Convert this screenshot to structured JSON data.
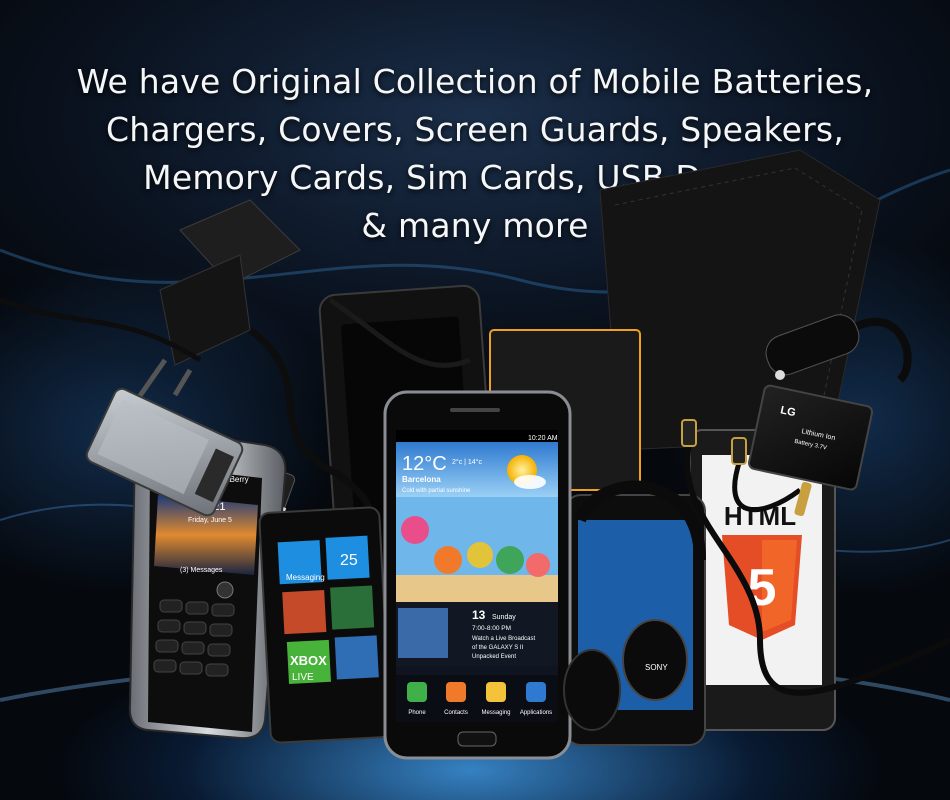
{
  "headline": {
    "line1": "We have Original Collection of Mobile Batteries,",
    "line2": "Chargers, Covers, Screen Guards, Speakers,",
    "line3": "Memory Cards, Sim Cards, USB Devices",
    "line4": "& many more"
  },
  "galaxy_phone": {
    "status_time": "10:20 AM",
    "weather_temp": "12°C",
    "weather_range": "2°c | 14°c",
    "weather_city": "Barcelona",
    "weather_desc": "Cold with partial sunshine",
    "event_date": "13",
    "event_day": "Sunday",
    "event_time": "7:00-8:00 PM",
    "event_line1": "Watch a Live Broadcast",
    "event_line2": "of the GALAXY S II",
    "event_line3": "Unpacked Event",
    "dock": [
      "Phone",
      "Contacts",
      "Messaging",
      "Applications"
    ]
  },
  "blackberry_phone": {
    "time": "12:21",
    "date": "Friday, June 5",
    "messages": "(3) Messages",
    "brand": "BlackBerry"
  },
  "windows_phone": {
    "tile_messaging": "Messaging",
    "tile_xbox": "XBOX",
    "tile_live": "LIVE",
    "tile_25": "25"
  },
  "html5_phone": {
    "text": "HTML",
    "badge": "5"
  },
  "battery_lg": {
    "brand": "LG",
    "line1": "Lithium Ion",
    "line2": "Battery 3.7V"
  },
  "headphones": {
    "brand": "SONY"
  },
  "colors": {
    "background": "#05080d",
    "glow": "#46aaff",
    "headline": "#f4f6f8",
    "html5_orange": "#e44d26",
    "sky": "#5aa0e0"
  }
}
